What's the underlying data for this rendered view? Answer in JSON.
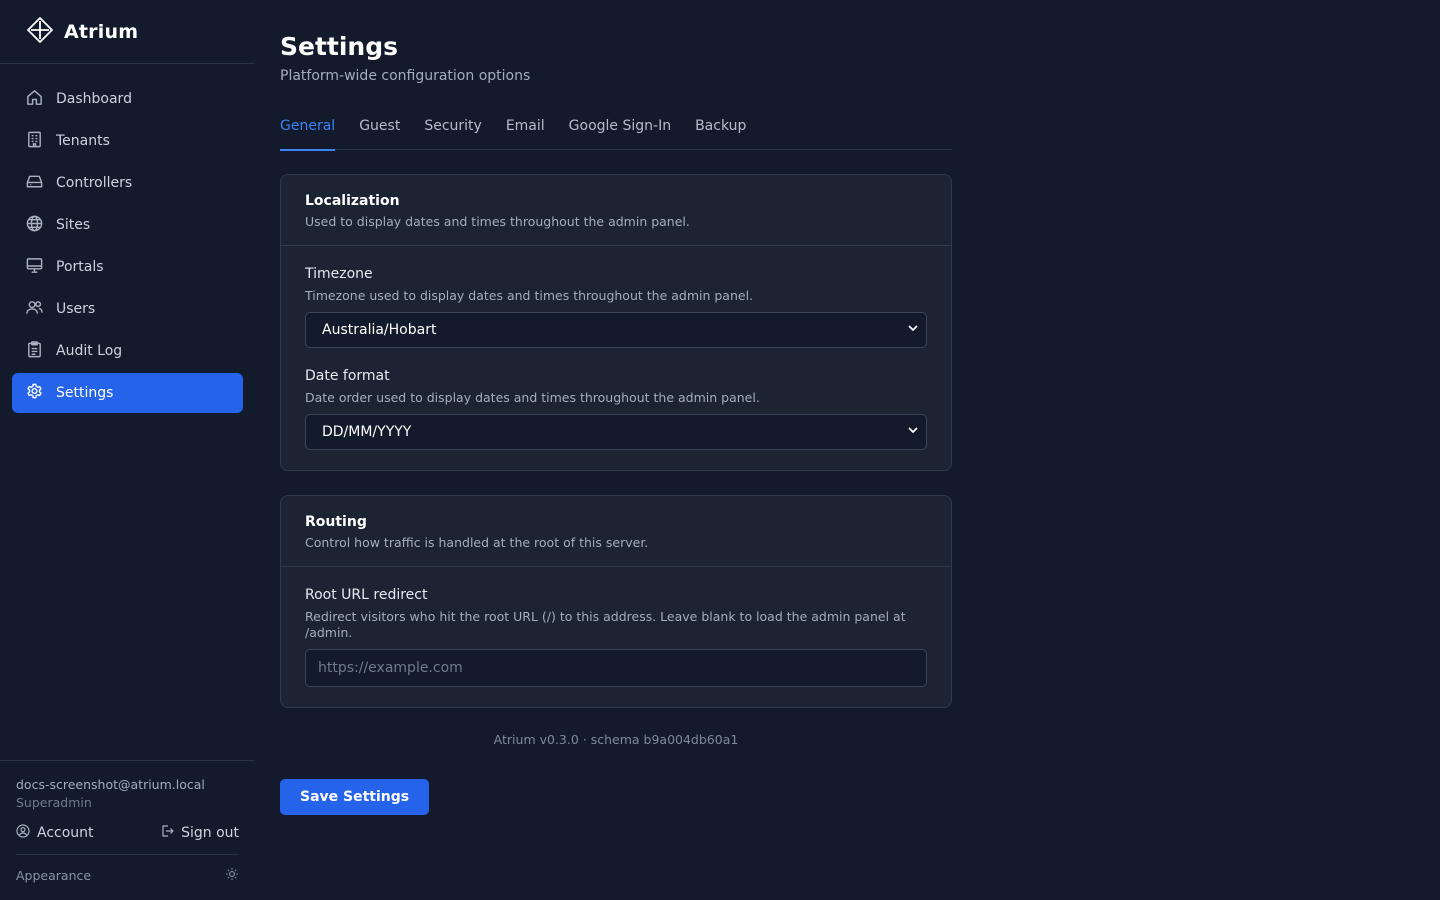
{
  "brand": {
    "name": "Atrium",
    "logo_icon": "compass-diamond-icon"
  },
  "sidebar": {
    "items": [
      {
        "label": "Dashboard",
        "icon": "home-icon"
      },
      {
        "label": "Tenants",
        "icon": "building-icon"
      },
      {
        "label": "Controllers",
        "icon": "hard-drive-icon"
      },
      {
        "label": "Sites",
        "icon": "globe-icon"
      },
      {
        "label": "Portals",
        "icon": "monitor-icon"
      },
      {
        "label": "Users",
        "icon": "users-icon"
      },
      {
        "label": "Audit Log",
        "icon": "clipboard-list-icon"
      },
      {
        "label": "Settings",
        "icon": "gear-icon",
        "active": true
      }
    ],
    "footer": {
      "email": "docs-screenshot@atrium.local",
      "role": "Superadmin",
      "account_label": "Account",
      "signout_label": "Sign out",
      "appearance_label": "Appearance"
    }
  },
  "page": {
    "title": "Settings",
    "subtitle": "Platform-wide configuration options"
  },
  "tabs": [
    {
      "label": "General",
      "active": true
    },
    {
      "label": "Guest"
    },
    {
      "label": "Security"
    },
    {
      "label": "Email"
    },
    {
      "label": "Google Sign-In"
    },
    {
      "label": "Backup"
    }
  ],
  "localization": {
    "title": "Localization",
    "description": "Used to display dates and times throughout the admin panel.",
    "timezone": {
      "label": "Timezone",
      "help": "Timezone used to display dates and times throughout the admin panel.",
      "value": "Australia/Hobart"
    },
    "date_format": {
      "label": "Date format",
      "help": "Date order used to display dates and times throughout the admin panel.",
      "value": "DD/MM/YYYY"
    }
  },
  "routing": {
    "title": "Routing",
    "description": "Control how traffic is handled at the root of this server.",
    "root_redirect": {
      "label": "Root URL redirect",
      "help": "Redirect visitors who hit the root URL (/) to this address. Leave blank to load the admin panel at /admin.",
      "value": "",
      "placeholder": "https://example.com"
    }
  },
  "version": "Atrium v0.3.0 · schema b9a004db60a1",
  "save_label": "Save Settings",
  "colors": {
    "background": "#121a2b",
    "card": "#1c2434",
    "accent": "#2563eb",
    "tab_active": "#3b82f6"
  }
}
